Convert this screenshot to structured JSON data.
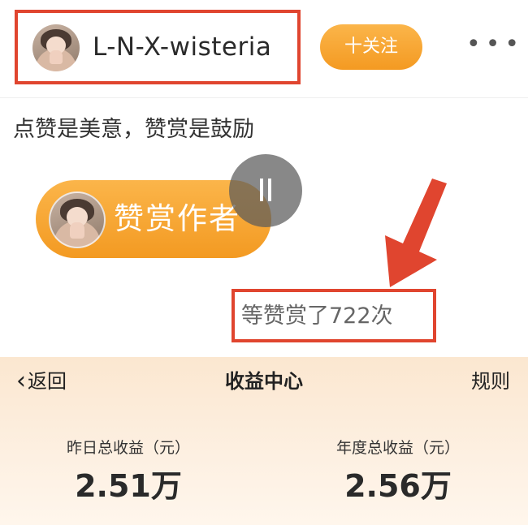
{
  "author": {
    "username": "L-N-X-wisteria",
    "follow_label": "十关注",
    "more_label": "•••"
  },
  "post": {
    "motto": "点赞是美意，赞赏是鼓励",
    "tip_button_label": "赞赏作者",
    "tip_count_text": "等赞赏了722次",
    "tip_count": 722
  },
  "income_center": {
    "back_label": "返回",
    "title": "收益中心",
    "rules_label": "规则",
    "stats": [
      {
        "label": "昨日总收益（元）",
        "value": "2.51万"
      },
      {
        "label": "年度总收益（元）",
        "value": "2.56万"
      }
    ]
  },
  "colors": {
    "highlight_border": "#e0452f",
    "accent_orange": "#f5a031",
    "income_background": "#fbe7d0"
  },
  "icons": {
    "back": "chevron-left-icon",
    "more": "more-dots-icon",
    "media": "pause-icon",
    "annotation": "red-arrow-icon"
  }
}
